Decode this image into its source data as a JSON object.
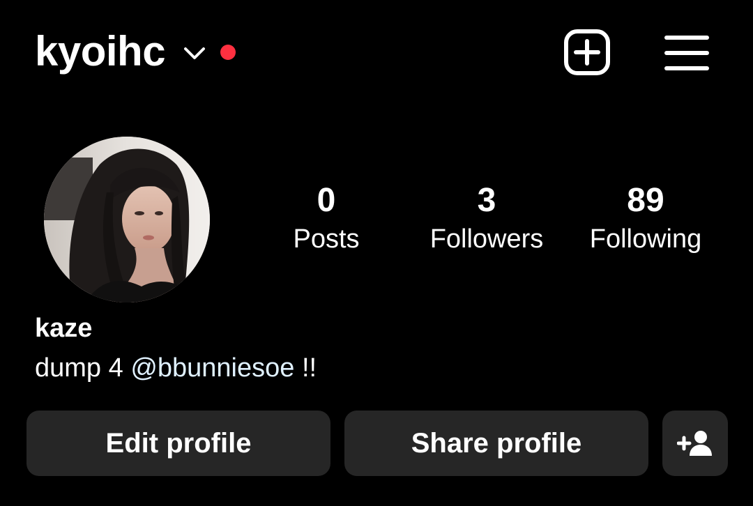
{
  "header": {
    "username": "kyoihc",
    "icons": {
      "switch": "chevron-down-icon",
      "create": "plus-square-icon",
      "menu": "hamburger-menu-icon"
    },
    "notification_dot_color": "#ff3040"
  },
  "profile": {
    "avatar": "profile-photo",
    "stats": [
      {
        "count": "0",
        "label": "Posts"
      },
      {
        "count": "3",
        "label": "Followers"
      },
      {
        "count": "89",
        "label": "Following"
      }
    ],
    "display_name": "kaze",
    "bio": {
      "prefix": "dump 4 ",
      "mention": "@bbunniesoe",
      "suffix": " !!"
    }
  },
  "actions": {
    "edit_label": "Edit profile",
    "share_label": "Share profile",
    "discover_icon": "add-person-icon",
    "button_color": "#262626"
  }
}
